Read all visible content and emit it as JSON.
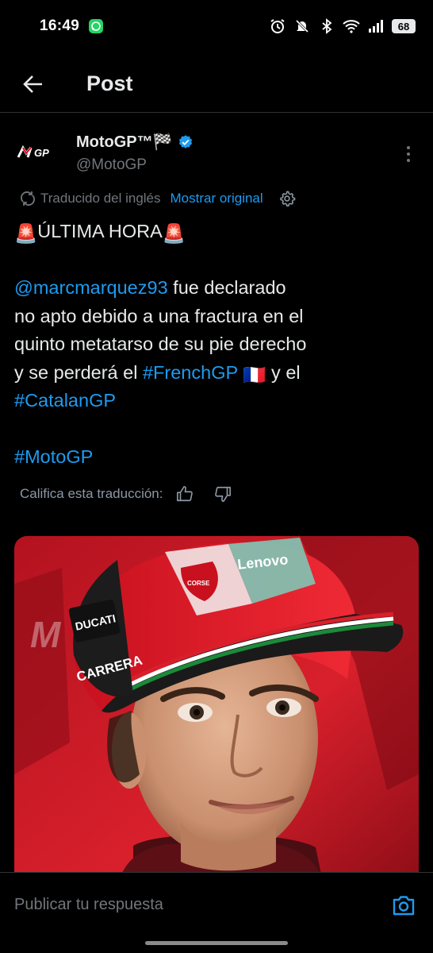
{
  "status_bar": {
    "time": "16:49",
    "battery": "68",
    "icons": [
      "whatsapp-icon",
      "alarm-icon",
      "mute-icon",
      "bluetooth-icon",
      "wifi-icon",
      "signal-icon",
      "battery-icon"
    ]
  },
  "header": {
    "back_icon": "arrow-left-icon",
    "title": "Post"
  },
  "author": {
    "display_name": "MotoGP™🏁",
    "handle": "@MotoGP",
    "verified": true,
    "avatar_icon": "motogp-logo-icon"
  },
  "translation": {
    "label": "Traducido del inglés",
    "show_original": "Mostrar original"
  },
  "tweet": {
    "headline_emoji": "🚨",
    "headline": "ÚLTIMA HORA",
    "mention": "@marcmarquez93",
    "text_1": " fue declarado",
    "text_2": "no apto debido a una fractura en el",
    "text_3": "quinto metatarso de su pie derecho",
    "text_4": "y se perderá el ",
    "hashtag_1": "#FrenchGP",
    "flag": "🇫🇷",
    "text_5": " y el",
    "hashtag_2": "#CatalanGP",
    "hashtag_3": "#MotoGP"
  },
  "rating": {
    "label": "Califica esta traducción:"
  },
  "media": {
    "cap_text_1": "Lenovo",
    "cap_text_2": "CARRERA",
    "cap_text_3": "DUCATI",
    "cap_text_4": "CORSE"
  },
  "reply": {
    "placeholder": "Publicar tu respuesta"
  },
  "colors": {
    "background": "#000000",
    "link": "#1d9bf0",
    "secondary_text": "#71767b",
    "verified": "#1d9bf0"
  }
}
